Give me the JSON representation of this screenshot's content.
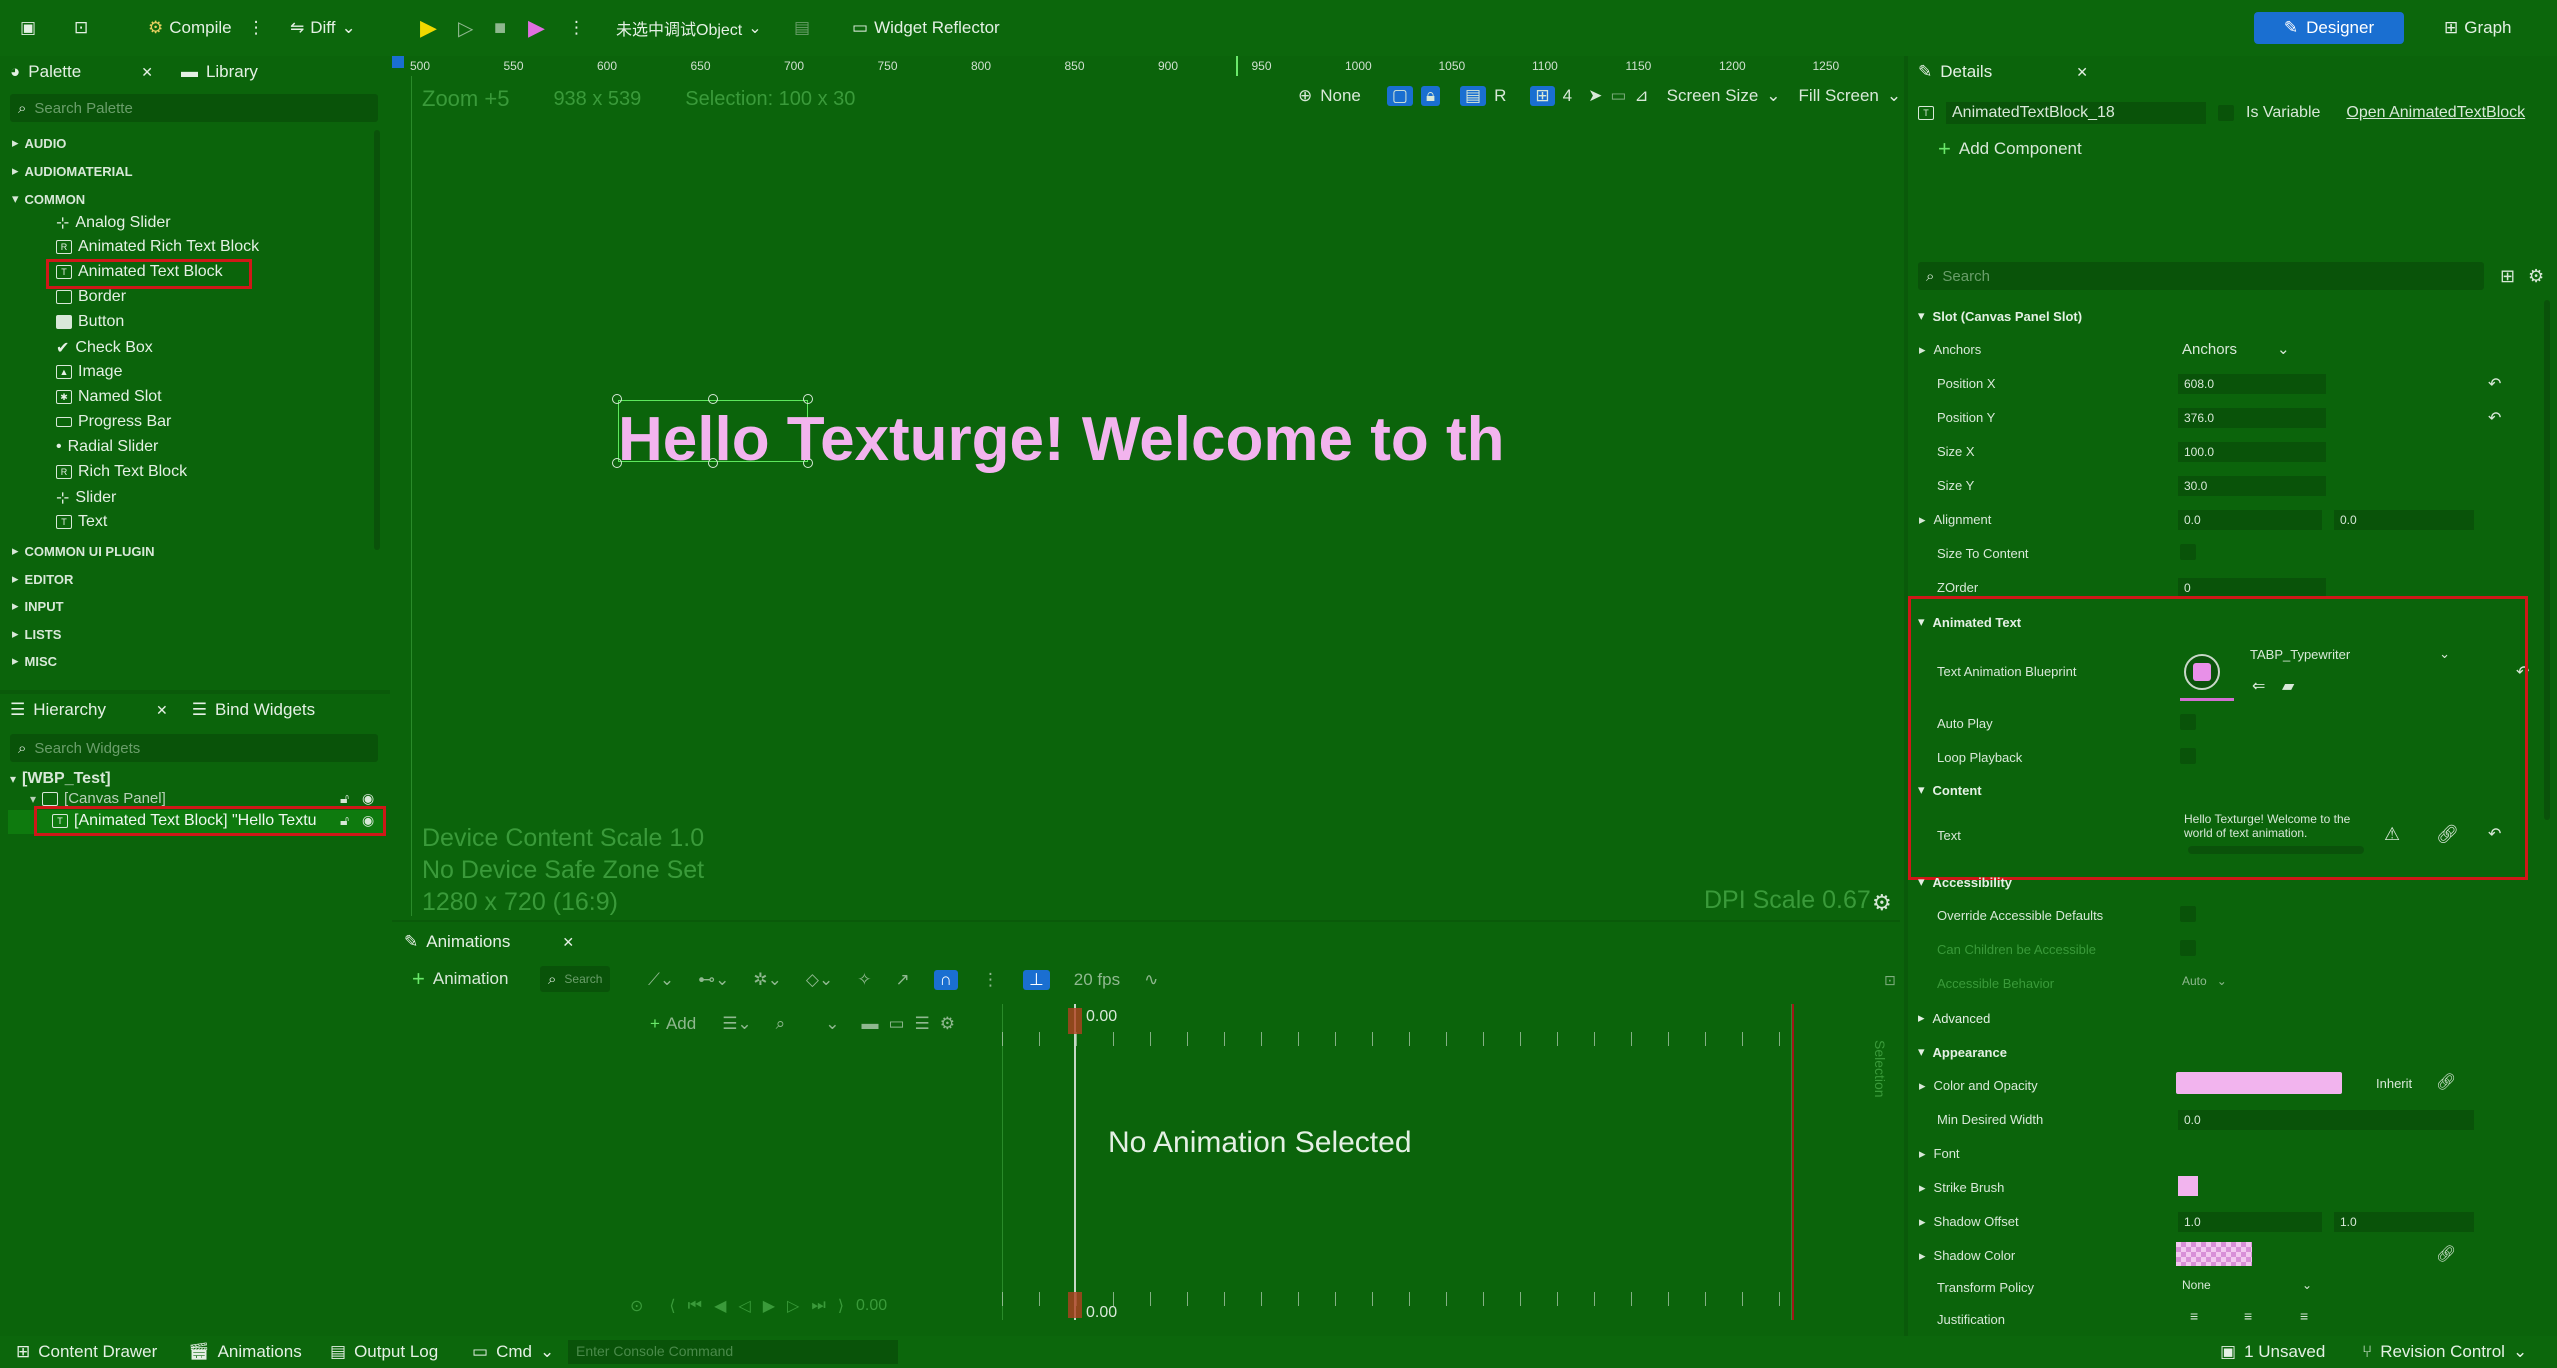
{
  "toolbar": {
    "compile": "Compile",
    "diff": "Diff",
    "debug_object": "未选中调试Object",
    "widget_reflector": "Widget Reflector",
    "designer": "Designer",
    "graph": "Graph"
  },
  "palette": {
    "tab": "Palette",
    "library_tab": "Library",
    "search_placeholder": "Search Palette",
    "categories": [
      "AUDIO",
      "AUDIOMATERIAL",
      "COMMON",
      "COMMON UI PLUGIN",
      "EDITOR",
      "INPUT",
      "LISTS",
      "MISC"
    ],
    "common_items": [
      "Analog Slider",
      "Animated Rich Text Block",
      "Animated Text Block",
      "Border",
      "Button",
      "Check Box",
      "Image",
      "Named Slot",
      "Progress Bar",
      "Radial Slider",
      "Rich Text Block",
      "Slider",
      "Text"
    ]
  },
  "hierarchy": {
    "tab": "Hierarchy",
    "bind_tab": "Bind Widgets",
    "search_placeholder": "Search Widgets",
    "root": "[WBP_Test]",
    "canvas": "[Canvas Panel]",
    "selected": "[Animated Text Block] \"Hello Textu"
  },
  "viewport": {
    "zoom": "Zoom +5",
    "size": "938 x 539",
    "selection": "Selection: 100 x 30",
    "none_label": "None",
    "r_label": "R",
    "grid_num": "4",
    "screen_size": "Screen Size",
    "fill_screen": "Fill Screen",
    "ruler_ticks": [
      "500",
      "550",
      "600",
      "650",
      "700",
      "750",
      "800",
      "850",
      "900",
      "950",
      "1000",
      "1050",
      "1100",
      "1150",
      "1200",
      "1250"
    ],
    "canvas_text": "Hello Texturge! Welcome to th",
    "device_scale": "Device Content Scale 1.0",
    "safe_zone": "No Device Safe Zone Set",
    "resolution": "1280 x 720 (16:9)",
    "dpi": "DPI Scale 0.67"
  },
  "animations": {
    "tab": "Animations",
    "add_animation": "Animation",
    "search_placeholder": "Search",
    "add": "Add",
    "fps": "20 fps",
    "time_top": "0.00",
    "time_bottom": "0.00",
    "time_left": "0.00",
    "empty": "No Animation Selected",
    "selection_vertical": "Selection"
  },
  "details": {
    "tab": "Details",
    "widget_name": "AnimatedTextBlock_18",
    "is_variable": "Is Variable",
    "open_link": "Open AnimatedTextBlock",
    "add_component": "Add Component",
    "search_placeholder": "Search",
    "slot_section": "Slot (Canvas Panel Slot)",
    "anchors_label": "Anchors",
    "anchors_value": "Anchors",
    "position_x_label": "Position X",
    "position_x": "608.0",
    "position_y_label": "Position Y",
    "position_y": "376.0",
    "size_x_label": "Size X",
    "size_x": "100.0",
    "size_y_label": "Size Y",
    "size_y": "30.0",
    "alignment_label": "Alignment",
    "alignment_x": "0.0",
    "alignment_y": "0.0",
    "size_to_content": "Size To Content",
    "zorder_label": "ZOrder",
    "zorder": "0",
    "animated_text_section": "Animated Text",
    "anim_blueprint_label": "Text Animation Blueprint",
    "anim_blueprint_value": "TABP_Typewriter",
    "auto_play": "Auto Play",
    "loop_playback": "Loop Playback",
    "content_section": "Content",
    "text_label": "Text",
    "text_value": "Hello Texturge! Welcome to the world of text animation.",
    "accessibility_section": "Accessibility",
    "override_accessible": "Override Accessible Defaults",
    "children_accessible": "Can Children be Accessible",
    "accessible_behavior": "Accessible Behavior",
    "accessible_behavior_value": "Auto",
    "advanced_section": "Advanced",
    "appearance_section": "Appearance",
    "color_opacity": "Color and Opacity",
    "inherit": "Inherit",
    "min_width_label": "Min Desired Width",
    "min_width": "0.0",
    "font_label": "Font",
    "strike_brush": "Strike Brush",
    "shadow_offset_label": "Shadow Offset",
    "shadow_offset_x": "1.0",
    "shadow_offset_y": "1.0",
    "shadow_color": "Shadow Color",
    "transform_policy_label": "Transform Policy",
    "transform_policy": "None",
    "justification": "Justification"
  },
  "bottombar": {
    "content_drawer": "Content Drawer",
    "animations": "Animations",
    "output_log": "Output Log",
    "cmd": "Cmd",
    "console_placeholder": "Enter Console Command",
    "unsaved": "1 Unsaved",
    "revision": "Revision Control"
  },
  "colors": {
    "background": "#0b640b",
    "accent_blue": "#1a6fd1",
    "highlight_red": "#d01818",
    "canvas_text_pink": "#f2b4ee",
    "selection_green": "#5ce85c"
  }
}
